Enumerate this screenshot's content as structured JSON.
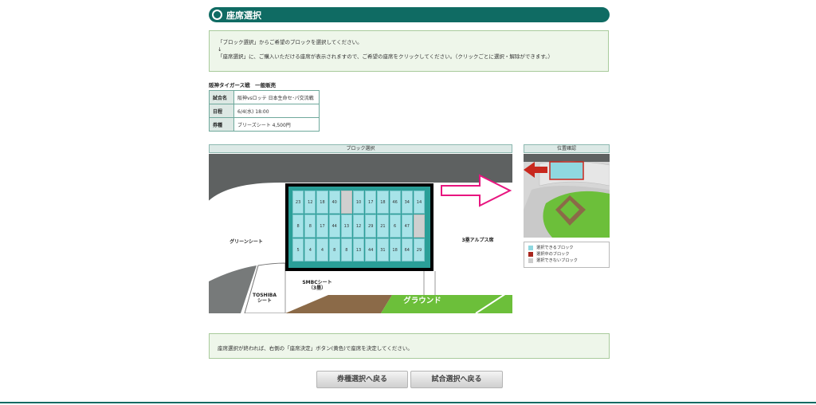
{
  "header": {
    "title": "座席選択"
  },
  "instructions": {
    "line1": "「ブロック選択」からご希望のブロックを選択してください。",
    "arrow": "↓",
    "line2": "「座席選択」に、ご購入いただける座席が表示されますので、ご希望の座席をクリックしてください。（クリックごとに選択・解除ができます。）"
  },
  "event": {
    "name": "阪神タイガース戦　一般販売",
    "rows": [
      {
        "label": "試合名",
        "value": "阪神vsロッテ 日本生命セ･パ交流戦"
      },
      {
        "label": "日程",
        "value": "6/4(水) 18:00"
      },
      {
        "label": "券種",
        "value": "ブリーズシート 4,500円"
      }
    ]
  },
  "block_panel": {
    "header": "ブロック選択",
    "labels": {
      "green_seat": "グリーンシート",
      "alps_3b": "3塁アルプス席",
      "smbc_line1": "SMBCシート",
      "smbc_line2": "（3塁）",
      "toshiba_line1": "TOSHIBA",
      "toshiba_line2": "シート",
      "ground": "グラウンド"
    },
    "blocks": [
      [
        "23",
        "12",
        "18",
        "40",
        "",
        "10",
        "17",
        "18",
        "46",
        "34",
        "14"
      ],
      [
        "8",
        "8",
        "17",
        "44",
        "13",
        "12",
        "29",
        "21",
        "6",
        "47",
        ""
      ],
      [
        "5",
        "4",
        "4",
        "8",
        "8",
        "13",
        "44",
        "31",
        "18",
        "64",
        "29"
      ]
    ]
  },
  "position_panel": {
    "header": "位置確認"
  },
  "legend": {
    "items": [
      {
        "label": "選択できるブロック",
        "color": "#8fd8e0"
      },
      {
        "label": "選択中のブロック",
        "color": "#a8261e"
      },
      {
        "label": "選択できないブロック",
        "color": "#cccccc"
      }
    ]
  },
  "notice": {
    "text": "座席選択が終われば、右側の「座席決定」ボタン(黄色)で座席を決定してください。"
  },
  "buttons": {
    "back_ticket": "券種選択へ戻る",
    "back_match": "試合選択へ戻る"
  },
  "colors": {
    "accent": "#0f6b63",
    "pink_arrow": "#e8157f",
    "red_arrow": "#c8281e",
    "ground_green": "#6cbf3a"
  }
}
